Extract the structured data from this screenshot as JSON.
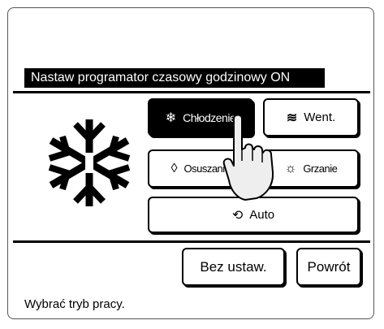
{
  "header": {
    "title": "Nastaw programator czasowy godzinowy ON"
  },
  "modes": [
    {
      "label": "Chłodzenie",
      "icon": "snowflake-icon",
      "glyph": "❄",
      "selected": true
    },
    {
      "label": "Went.",
      "icon": "fan-icon",
      "glyph": "≋",
      "selected": false
    },
    {
      "label": "Osuszanie",
      "icon": "drop-icon",
      "glyph": "◊",
      "selected": false
    },
    {
      "label": "Grzanie",
      "icon": "sun-icon",
      "glyph": "☼",
      "selected": false
    },
    {
      "label": "Auto",
      "icon": "auto-icon",
      "glyph": "⟲",
      "selected": false
    }
  ],
  "footer": {
    "reset_label": "Bez ustaw.",
    "back_label": "Powrót",
    "status_text": "Wybrać tryb pracy."
  },
  "colors": {
    "foreground": "#000000",
    "background": "#ffffff"
  }
}
